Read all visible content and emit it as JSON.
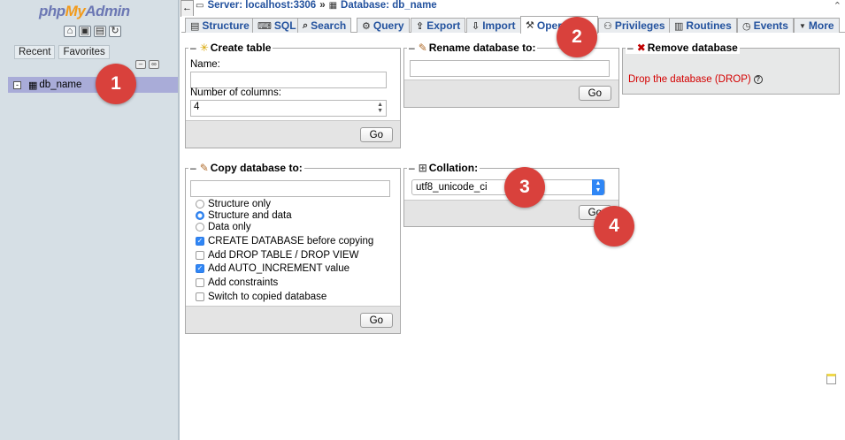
{
  "nav": {
    "logo": {
      "part1": "php",
      "part2": "My",
      "part3": "Admin"
    },
    "icons": [
      "home-icon",
      "docs-icon",
      "sql-docs-icon",
      "reload-icon"
    ],
    "tabs": [
      "Recent",
      "Favorites"
    ],
    "tree": {
      "db_name": "db_name"
    }
  },
  "header": {
    "back_glyph": "←",
    "server": "Server: localhost:3306",
    "sep": "»",
    "database": "Database: db_name",
    "scroll_glyph": "⌃"
  },
  "tabs": [
    {
      "label": "Structure",
      "icon": "▤"
    },
    {
      "label": "SQL",
      "icon": "⌨"
    },
    {
      "label": "Search",
      "icon": "⌕"
    },
    {
      "label": "Query",
      "icon": "⚙"
    },
    {
      "label": "Export",
      "icon": "⇪"
    },
    {
      "label": "Import",
      "icon": "⇩"
    },
    {
      "label": "Operations",
      "icon": "⚒"
    },
    {
      "label": "Privileges",
      "icon": "⚇"
    },
    {
      "label": "Routines",
      "icon": "▥"
    },
    {
      "label": "Events",
      "icon": "◷"
    },
    {
      "label": "More",
      "icon": "▼"
    }
  ],
  "create_table": {
    "legend": "Create table",
    "name_label": "Name:",
    "name_value": "",
    "columns_label": "Number of columns:",
    "columns_value": "4",
    "go": "Go"
  },
  "rename_db": {
    "legend": "Rename database to:",
    "value": "",
    "go": "Go"
  },
  "remove_db": {
    "legend": "Remove database",
    "drop_link": "Drop the database (DROP)"
  },
  "copy_db": {
    "legend": "Copy database to:",
    "value": "",
    "radios": [
      {
        "label": "Structure only",
        "checked": false
      },
      {
        "label": "Structure and data",
        "checked": true
      },
      {
        "label": "Data only",
        "checked": false
      }
    ],
    "checks": [
      {
        "label": "CREATE DATABASE before copying",
        "checked": true
      },
      {
        "label": "Add DROP TABLE / DROP VIEW",
        "checked": false
      },
      {
        "label": "Add AUTO_INCREMENT value",
        "checked": true
      },
      {
        "label": "Add constraints",
        "checked": false
      },
      {
        "label": "Switch to copied database",
        "checked": false
      }
    ],
    "go": "Go"
  },
  "collation": {
    "legend": "Collation:",
    "selected": "utf8_unicode_ci",
    "go": "Go"
  },
  "badges": [
    "1",
    "2",
    "3",
    "4"
  ],
  "colors": {
    "accent": "#23529e",
    "badge": "#d9413c",
    "drop_link": "#d40000",
    "selected_row": "#a9acd8"
  }
}
